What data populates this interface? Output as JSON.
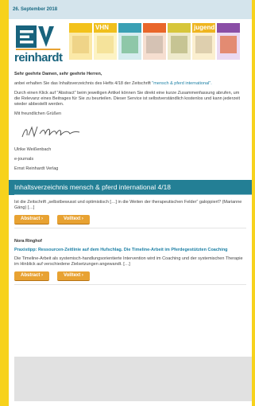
{
  "header": {
    "date": "26. September 2018"
  },
  "brand": {
    "logo_text": "reinhardt",
    "colors": {
      "teal": "#18637d",
      "orange": "#e8a232",
      "yellow": "#f7d21c",
      "toc": "#237f95"
    }
  },
  "covers": [
    {
      "label": "",
      "band": "#f3c21b",
      "tint": "#eacb7a"
    },
    {
      "label": "VHN",
      "band": "#f0bf1c",
      "tint": "#f1dc8a"
    },
    {
      "label": "",
      "band": "#3aa0b4",
      "tint": "#6fb88a"
    },
    {
      "label": "",
      "band": "#e9662a",
      "tint": "#c7b6a8"
    },
    {
      "label": "",
      "band": "#d7c63a",
      "tint": "#b5b37a"
    },
    {
      "label": "jugend",
      "band": "#efb520",
      "tint": "#d2c2a0"
    },
    {
      "label": "",
      "band": "#8a4ea6",
      "tint": "#e06a3c"
    }
  ],
  "letter": {
    "salutation": "Sehr geehrte Damen, sehr geehrte Herren,",
    "intro": "anbei erhalten Sie das Inhaltsverzeichnis des Hefts 4/18 der Zeitschrift",
    "journal_link": "\"mensch & pferd international\".",
    "explanation": "Durch einen Klick auf \"Abstract\" beim jeweiligen Artikel können Sie direkt eine kurze Zusammenfassung abrufen, um die Relevanz eines Beitrages für Sie zu beurteilen. Dieser Service ist selbstverständlich kostenlos und kann jederzeit wieder abbestellt werden.",
    "closing": "Mit freundlichen Grüßen",
    "sig_name": "Ulrike Weißenbach",
    "sig_role": "e-journals",
    "sig_company": "Ernst Reinhardt Verlag"
  },
  "toc": {
    "title": "Inhaltsverzeichnis mensch & pferd international 4/18"
  },
  "articles": [
    {
      "author": "",
      "title": "",
      "text": "Ist die Zeitschrift „selbstbewusst und optimistisch […] in die Weiten der therapeutischen Felder“ galoppiert? (Marianne Gäng) […]",
      "abstract_label": "Abstract ›",
      "fulltext_label": "Volltext ›"
    },
    {
      "author": "Nora Ringhof",
      "title": "Praxistipp: Ressourcen-Zeitlinie auf dem Hufschlag. Die Timeline-Arbeit im Pferdegestützten Coaching",
      "text": "Die Timeline-Arbeit als systemisch-handlungsorientierte Intervention wird im Coaching und der systemischen Therapie im Hinblick auf verschiedene Zielsetzungen angewandt. […]",
      "abstract_label": "Abstract ›",
      "fulltext_label": "Volltext ›"
    }
  ]
}
